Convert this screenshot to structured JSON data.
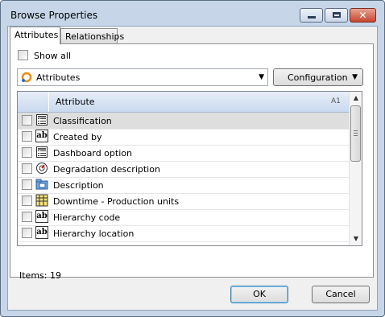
{
  "window": {
    "title": "Browse Properties"
  },
  "tabs": [
    {
      "label": "Attributes",
      "active": true
    },
    {
      "label": "Relationships",
      "active": false
    }
  ],
  "show_all": {
    "label": "Show all",
    "checked": false
  },
  "category_combo": {
    "value": "Attributes"
  },
  "configuration_button": {
    "label": "Configuration"
  },
  "grid": {
    "column_header": "Attribute",
    "sort_indicator": "A1",
    "rows": [
      {
        "label": "Classification",
        "icon": "list-icon",
        "selected": true
      },
      {
        "label": "Created by",
        "icon": "text-ab-icon",
        "selected": false
      },
      {
        "label": "Dashboard option",
        "icon": "list-icon",
        "selected": false
      },
      {
        "label": "Degradation description",
        "icon": "gauge-icon",
        "selected": false
      },
      {
        "label": "Description",
        "icon": "folder-icon",
        "selected": false
      },
      {
        "label": "Downtime - Production units",
        "icon": "grid-icon",
        "selected": false
      },
      {
        "label": "Hierarchy code",
        "icon": "text-ab-icon",
        "selected": false
      },
      {
        "label": "Hierarchy location",
        "icon": "text-ab-icon",
        "selected": false
      }
    ]
  },
  "items_count": "Items:  19",
  "buttons": {
    "ok": "OK",
    "cancel": "Cancel"
  },
  "colors": {
    "title_bar": "#c6d6e8",
    "close_button": "#c6452f",
    "selected_row": "#dedede",
    "header": "#c9d9ee"
  }
}
